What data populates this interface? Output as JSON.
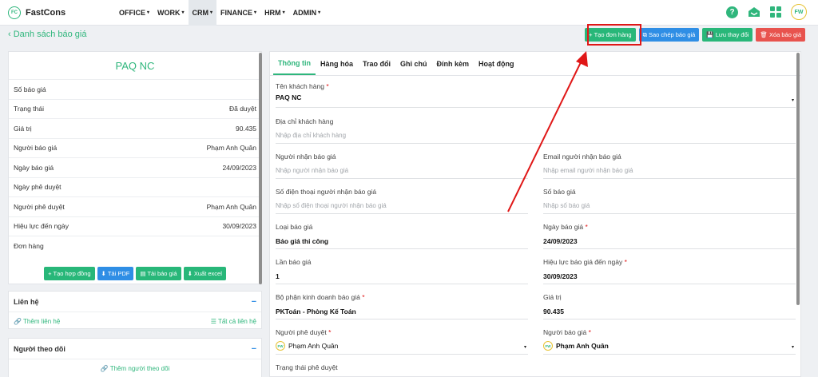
{
  "brand": {
    "name": "FastCons",
    "logo_text": "FC"
  },
  "nav": {
    "menu": [
      {
        "label": "OFFICE",
        "name": "menu-office",
        "active": false
      },
      {
        "label": "WORK",
        "name": "menu-work",
        "active": false
      },
      {
        "label": "CRM",
        "name": "menu-crm",
        "active": true
      },
      {
        "label": "FINANCE",
        "name": "menu-finance",
        "active": false
      },
      {
        "label": "HRM",
        "name": "menu-hrm",
        "active": false
      },
      {
        "label": "ADMIN",
        "name": "menu-admin",
        "active": false
      }
    ],
    "caret": "▾",
    "help": "?",
    "avatar": "FW"
  },
  "breadcrumb": {
    "back": "‹ Danh sách báo giá"
  },
  "actions": [
    {
      "label": "Tạo đơn hàng",
      "icon": "+",
      "color": "green",
      "name": "create-order-button"
    },
    {
      "label": "Sao chép báo giá",
      "icon": "⧉",
      "color": "blue",
      "name": "copy-quote-button"
    },
    {
      "label": "Lưu thay đổi",
      "icon": "💾",
      "color": "green",
      "name": "save-changes-button"
    },
    {
      "label": "Xóa báo giá",
      "icon": "🗑",
      "color": "red",
      "name": "delete-quote-button"
    }
  ],
  "summary": {
    "title": "PAQ NC",
    "rows": [
      {
        "label": "Số báo giá",
        "value": ""
      },
      {
        "label": "Trạng thái",
        "value": "Đã duyệt"
      },
      {
        "label": "Giá trị",
        "value": "90.435"
      },
      {
        "label": "Người báo giá",
        "value": "Phạm Anh Quân"
      },
      {
        "label": "Ngày báo giá",
        "value": "24/09/2023"
      },
      {
        "label": "Ngày phê duyệt",
        "value": ""
      },
      {
        "label": "Người phê duyệt",
        "value": "Phạm Anh Quân"
      },
      {
        "label": "Hiệu lực đến ngày",
        "value": "30/09/2023"
      },
      {
        "label": "Đơn hàng",
        "value": ""
      }
    ],
    "buttons": [
      {
        "label": "Tạo hợp đồng",
        "icon": "+",
        "color": "green",
        "name": "create-contract-button"
      },
      {
        "label": "Tải PDF",
        "icon": "⬇",
        "color": "blue",
        "name": "download-pdf-button"
      },
      {
        "label": "Tải báo giá",
        "icon": "▤",
        "color": "green",
        "name": "download-quote-button"
      },
      {
        "label": "Xuất excel",
        "icon": "⬇",
        "color": "green",
        "name": "export-excel-button"
      }
    ]
  },
  "contacts": {
    "title": "Liên hệ",
    "toggle": "−",
    "add": "Thêm liên hệ",
    "all": "Tất cả liên hệ",
    "add_icon": "🔗",
    "all_icon": "☰"
  },
  "followers": {
    "title": "Người theo dõi",
    "toggle": "−",
    "add": "Thêm người theo dõi",
    "add_icon": "🔗"
  },
  "tabs": [
    {
      "label": "Thông tin",
      "active": true,
      "name": "tab-info"
    },
    {
      "label": "Hàng hóa",
      "active": false,
      "name": "tab-goods"
    },
    {
      "label": "Trao đổi",
      "active": false,
      "name": "tab-discussion"
    },
    {
      "label": "Ghi chú",
      "active": false,
      "name": "tab-notes"
    },
    {
      "label": "Đính kèm",
      "active": false,
      "name": "tab-attachments"
    },
    {
      "label": "Hoạt động",
      "active": false,
      "name": "tab-activity"
    }
  ],
  "form": {
    "customer": {
      "label": "Tên khách hàng",
      "value": "PAQ NC"
    },
    "address": {
      "label": "Địa chỉ khách hàng",
      "placeholder": "Nhập địa chỉ khách hàng"
    },
    "recipient": {
      "label": "Người nhận báo giá",
      "placeholder": "Nhập người nhận báo giá"
    },
    "recipient_email": {
      "label": "Email người nhận báo giá",
      "placeholder": "Nhập email người nhận báo giá"
    },
    "recipient_phone": {
      "label": "Số điện thoại người nhận báo giá",
      "placeholder": "Nhập số điện thoại người nhận báo giá"
    },
    "quote_number": {
      "label": "Số báo giá",
      "placeholder": "Nhập số báo giá"
    },
    "quote_type": {
      "label": "Loại báo giá",
      "value": "Báo giá thi công"
    },
    "quote_date": {
      "label": "Ngày báo giá",
      "value": "24/09/2023"
    },
    "quote_count": {
      "label": "Lần báo giá",
      "value": "1"
    },
    "valid_until": {
      "label": "Hiệu lực báo giá đến ngày",
      "value": "30/09/2023"
    },
    "department": {
      "label": "Bộ phận kinh doanh báo giá",
      "value": "PKToán - Phòng Kế Toán"
    },
    "amount": {
      "label": "Giá trị",
      "value": "90.435"
    },
    "approver": {
      "label": "Người phê duyệt",
      "value": "Phạm Anh Quân"
    },
    "quoter": {
      "label": "Người báo giá",
      "value": "Phạm Anh Quân"
    },
    "approval_status": {
      "label": "Trạng thái phê duyệt"
    },
    "required_mark": "*",
    "dropdown_caret": "▾"
  },
  "colors": {
    "accent": "#2fb67c",
    "blue": "#2f8ee5",
    "red": "#e8534e",
    "annotation": "#e01717"
  }
}
